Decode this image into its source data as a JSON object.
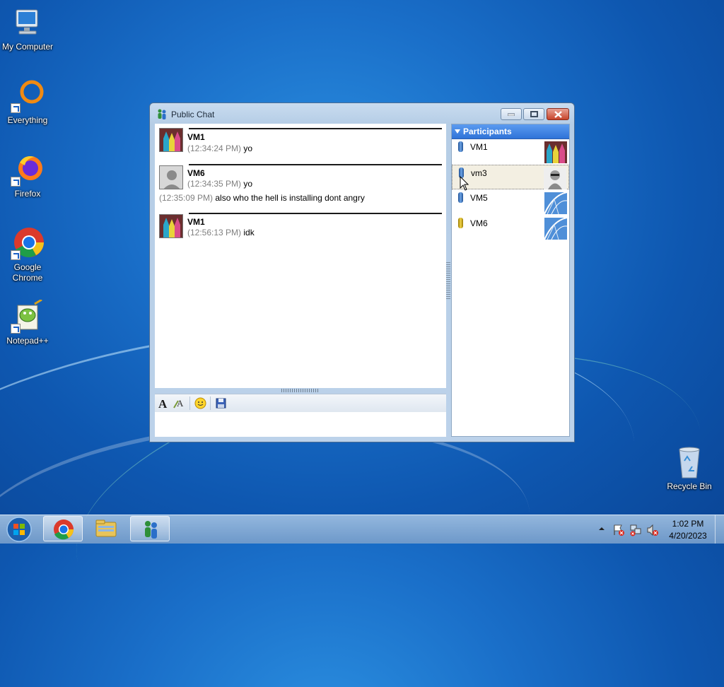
{
  "desktop": {
    "icons": [
      {
        "label": "My Computer"
      },
      {
        "label": "Everything"
      },
      {
        "label": "Firefox"
      },
      {
        "label": "Google Chrome"
      },
      {
        "label": "Notepad++"
      },
      {
        "label": "Recycle Bin"
      }
    ]
  },
  "window": {
    "title": "Public Chat"
  },
  "chat": {
    "messages": [
      {
        "name": "VM1",
        "lines": [
          {
            "time": "(12:34:24 PM)",
            "text": " yo"
          }
        ]
      },
      {
        "name": "VM6",
        "lines": [
          {
            "time": "(12:34:35 PM)",
            "text": " yo"
          },
          {
            "time": "(12:35:09 PM)",
            "text": " also who the hell is installing dont angry"
          }
        ]
      },
      {
        "name": "VM1",
        "lines": [
          {
            "time": "(12:56:13 PM)",
            "text": " idk"
          }
        ]
      }
    ],
    "input_value": ""
  },
  "participants": {
    "header": "Participants",
    "items": [
      {
        "name": "VM1",
        "status_color": "#2f6fbf"
      },
      {
        "name": "vm3",
        "status_color": "#2f6fbf"
      },
      {
        "name": "VM5",
        "status_color": "#2f6fbf"
      },
      {
        "name": "VM6",
        "status_color": "#d6b41e"
      }
    ]
  },
  "taskbar": {
    "time": "1:02 PM",
    "date": "4/20/2023"
  }
}
